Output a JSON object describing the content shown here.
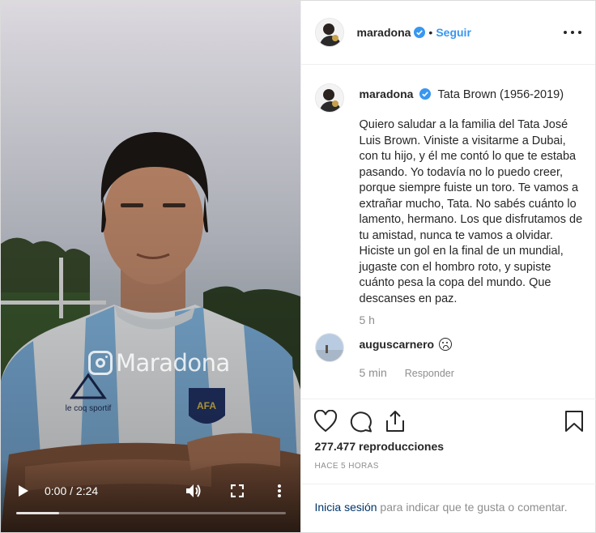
{
  "post": {
    "author": "maradona",
    "follow_label": "Seguir",
    "dot_separator": "•",
    "verified": true
  },
  "colors": {
    "link_blue": "#3897f0",
    "dark_link": "#003569",
    "muted": "#8e8e8e",
    "text": "#262626"
  },
  "video": {
    "watermark": "Maradona",
    "time": "0:00 / 2:24",
    "progress_fraction": 0.16,
    "icons": [
      "play-icon",
      "volume-icon",
      "fullscreen-icon",
      "more-vertical-icon"
    ]
  },
  "caption": {
    "username": "maradona",
    "title": "Tata Brown (1956-2019)",
    "body": "Quiero saludar a la familia del Tata José Luis Brown. Viniste a visitarme a Dubai, con tu hijo, y él me contó lo que te estaba pasando. Yo todavía no lo puedo creer, porque siempre fuiste un toro. Te vamos a extrañar mucho, Tata. No sabés cuánto lo lamento, hermano. Los que disfrutamos de tu amistad, nunca te vamos a olvidar. Hiciste un gol en la final de un mundial, jugaste con el hombro roto, y supiste cuánto pesa la copa del mundo. Que descanses en paz.",
    "time": "5 h"
  },
  "comment": {
    "username": "auguscarnero",
    "emoji": "crying-face-icon",
    "time": "5 min",
    "reply_label": "Responder"
  },
  "actions": {
    "icons": [
      "heart-icon",
      "comment-icon",
      "share-icon",
      "bookmark-icon"
    ]
  },
  "stats": {
    "views": "277.477 reproducciones",
    "timestamp": "Hace 5 horas"
  },
  "login": {
    "link": "Inicia sesión",
    "rest": " para indicar que te gusta o comentar."
  }
}
